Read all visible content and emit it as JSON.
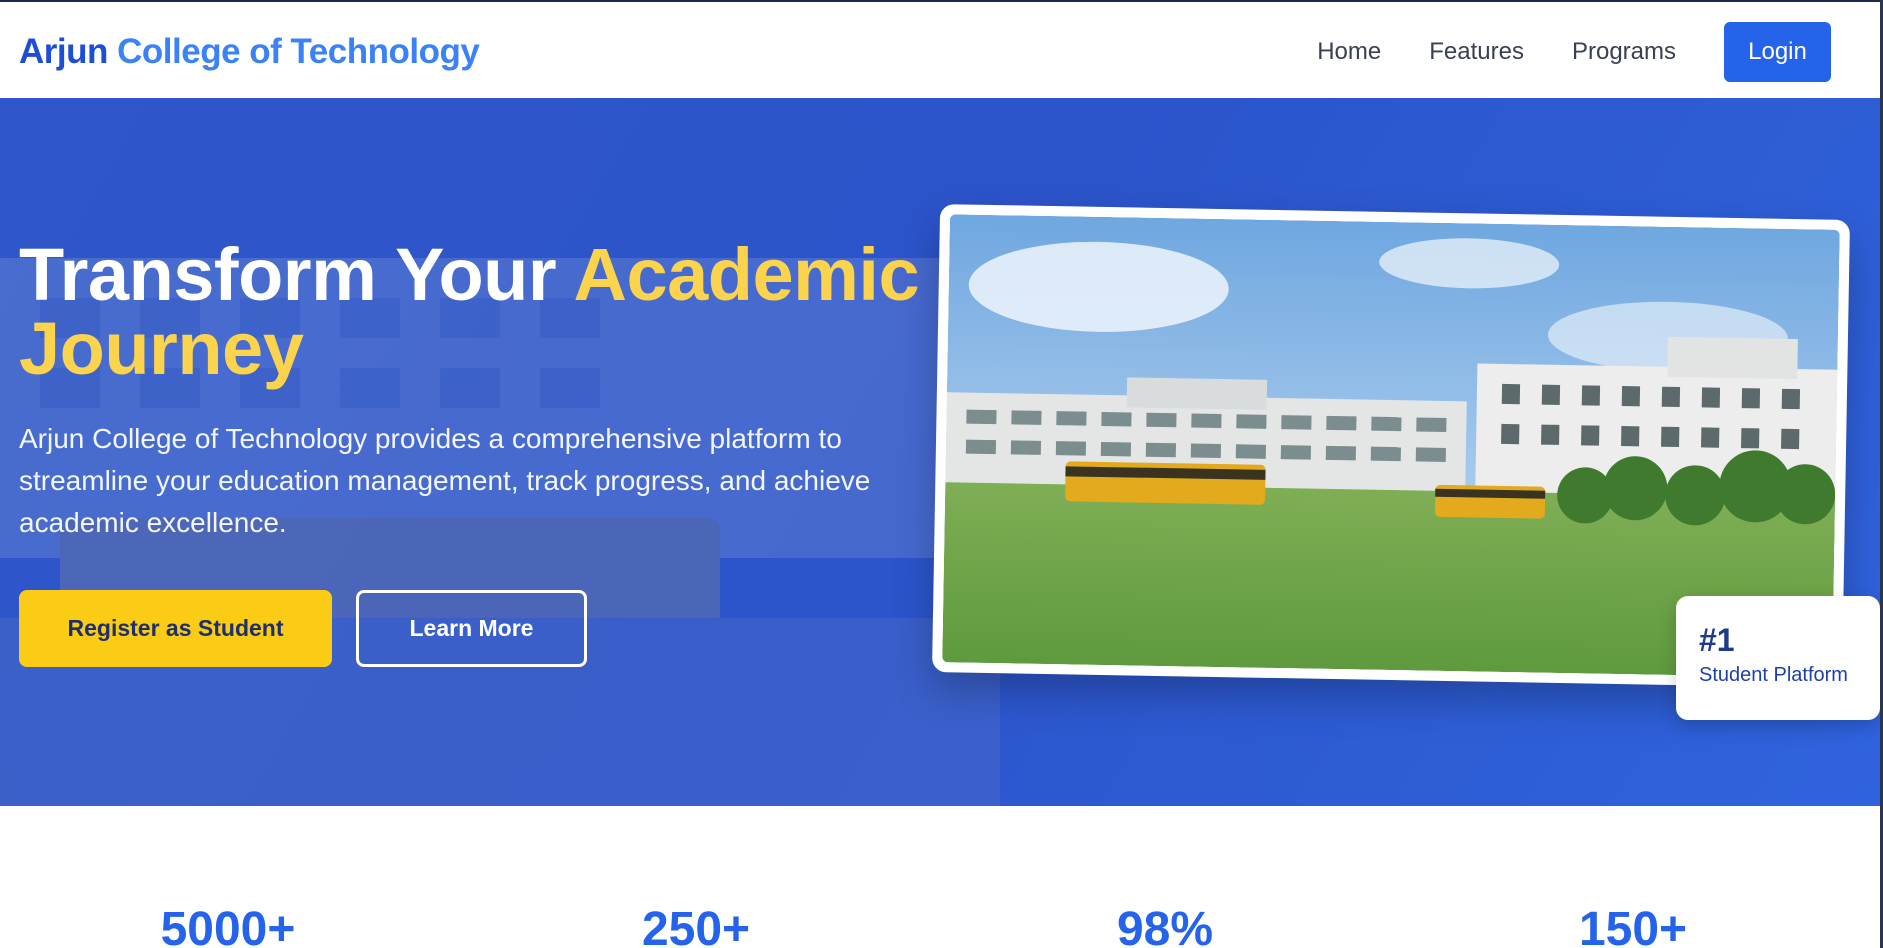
{
  "header": {
    "brand_part1": "Arjun",
    "brand_part2": "College of Technology",
    "nav": [
      "Home",
      "Features",
      "Programs"
    ],
    "login_label": "Login"
  },
  "hero": {
    "title_part1": "Transform Your",
    "title_highlight1": "Academic",
    "title_highlight2": "Journey",
    "description": "Arjun College of Technology provides a comprehensive platform to streamline your education management, track progress, and achieve academic excellence.",
    "register_label": "Register as Student",
    "learn_more_label": "Learn More",
    "badge_number": "#1",
    "badge_label": "Student Platform"
  },
  "stats": [
    "5000+",
    "250+",
    "98%",
    "150+"
  ],
  "colors": {
    "primary": "#2563eb",
    "hero_bg": "#2f57c9",
    "accent_yellow": "#facc15",
    "highlight_text": "#fcd34d"
  }
}
